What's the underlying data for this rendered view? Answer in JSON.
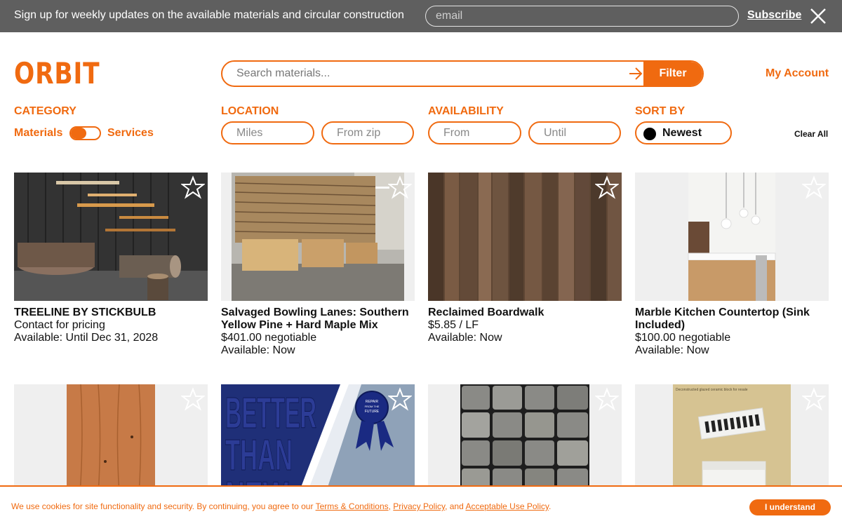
{
  "banner": {
    "text": "Sign up for weekly updates on the available materials and circular construction",
    "email_placeholder": "email",
    "subscribe_label": "Subscribe"
  },
  "header": {
    "logo": "ORBIT",
    "search_placeholder": "Search materials...",
    "filter_label": "Filter",
    "account_label": "My Account"
  },
  "filters": {
    "category": {
      "label": "CATEGORY",
      "left": "Materials",
      "right": "Services"
    },
    "location": {
      "label": "LOCATION",
      "miles_placeholder": "Miles",
      "zip_placeholder": "From zip"
    },
    "availability": {
      "label": "AVAILABILITY",
      "from_placeholder": "From",
      "until_placeholder": "Until"
    },
    "sort": {
      "label": "SORT BY",
      "value": "Newest"
    },
    "clear_label": "Clear All"
  },
  "listings": [
    {
      "title": "TREELINE BY STICKBULB",
      "price": "Contact for pricing",
      "availability": "Available: Until Dec 31, 2028"
    },
    {
      "title": "Salvaged Bowling Lanes: Southern Yellow Pine + Hard Maple Mix",
      "price": "$401.00 negotiable",
      "availability": "Available: Now"
    },
    {
      "title": "Reclaimed Boardwalk",
      "price": "$5.85 / LF",
      "availability": "Available: Now"
    },
    {
      "title": "Marble Kitchen Countertop (Sink Included)",
      "price": "$100.00 negotiable",
      "availability": "Available: Now"
    }
  ],
  "second_row": {
    "poster_text": [
      "BETTER",
      "THAN",
      "NEW"
    ],
    "ribbon_text": [
      "REPAIR",
      "FROM THE",
      "FUTURE"
    ],
    "block_caption": "Deconstructed glazed ceramic block for resale"
  },
  "cookie": {
    "text_before": "We use cookies for site functionality and security. By continuing, you agree to our ",
    "terms": "Terms & Conditions",
    "sep1": ", ",
    "privacy": "Privacy Policy",
    "sep2": ", and ",
    "aup": "Acceptable Use Policy",
    "end": ".",
    "button": "I understand"
  },
  "colors": {
    "accent": "#f06a10",
    "banner_bg": "#5f5f5f"
  },
  "icons": [
    "close-icon",
    "arrow-right-icon",
    "star-icon"
  ]
}
